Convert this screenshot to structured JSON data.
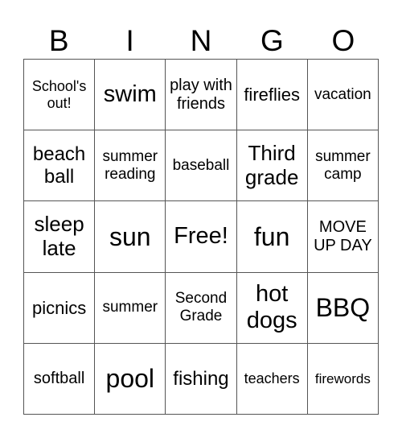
{
  "header": [
    "B",
    "I",
    "N",
    "G",
    "O"
  ],
  "rows": [
    [
      "School's out!",
      "swim",
      "play with friends",
      "fireflies",
      "vacation"
    ],
    [
      "beach ball",
      "summer reading",
      "baseball",
      "Third grade",
      "summer camp"
    ],
    [
      "sleep late",
      "sun",
      "Free!",
      "fun",
      "MOVE UP DAY"
    ],
    [
      "picnics",
      "summer",
      "Second Grade",
      "hot dogs",
      "BBQ"
    ],
    [
      "softball",
      "pool",
      "fishing",
      "teachers",
      "firewords"
    ]
  ]
}
